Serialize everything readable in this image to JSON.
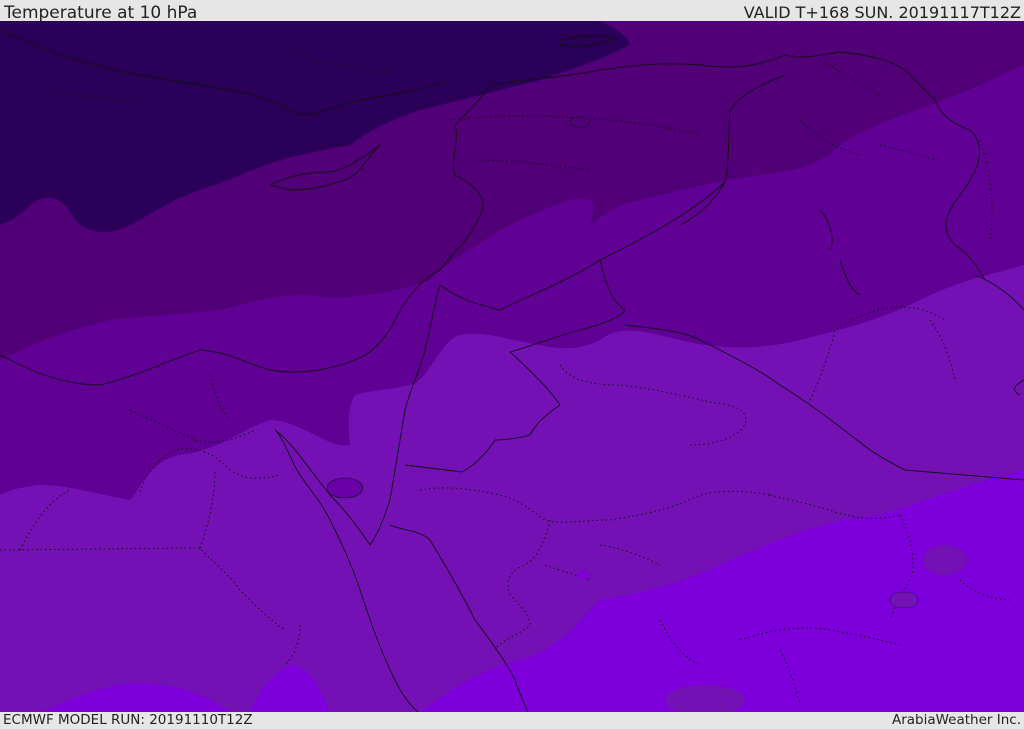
{
  "header": {
    "title": "Temperature at 10 hPa",
    "valid_time": "VALID T+168 SUN. 20191117T12Z"
  },
  "footer": {
    "model_run": "ECMWF MODEL RUN: 20191110T12Z",
    "credit": "ArabiaWeather Inc."
  },
  "map": {
    "colors": {
      "band_1": "#2a0058",
      "band_2": "#510078",
      "band_3": "#600094",
      "band_4": "#7411b4",
      "band_5": "#7d00dc"
    },
    "borders": {
      "coast": "#111111",
      "political": "#111111"
    }
  }
}
